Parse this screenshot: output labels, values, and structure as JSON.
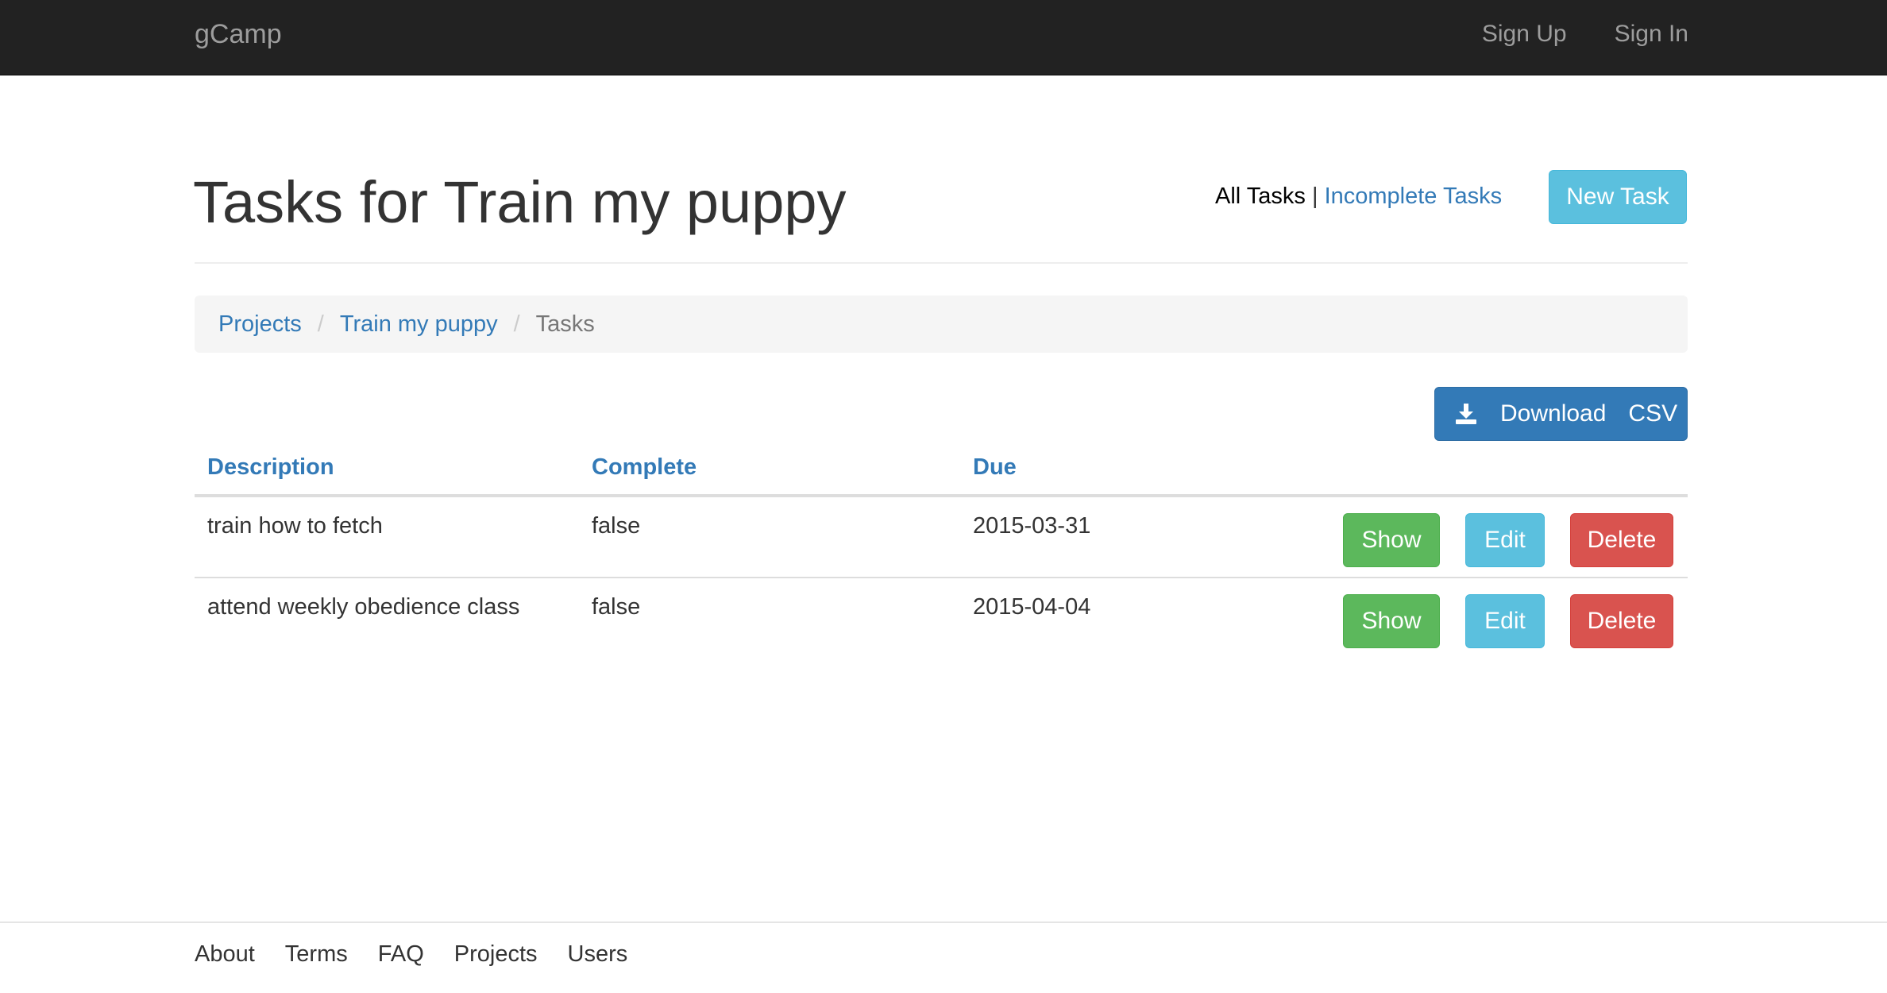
{
  "navbar": {
    "brand": "gCamp",
    "links": [
      "Sign Up",
      "Sign In"
    ]
  },
  "header": {
    "title": "Tasks for Train my puppy",
    "filter_all": "All Tasks",
    "filter_separator": "|",
    "filter_incomplete": "Incomplete Tasks",
    "new_task_label": "New Task"
  },
  "breadcrumb": {
    "items": [
      "Projects",
      "Train my puppy",
      "Tasks"
    ],
    "separator": "/"
  },
  "download": {
    "label_word1": "Download",
    "label_word2": "CSV",
    "icon": "download-icon"
  },
  "table": {
    "columns": [
      "Description",
      "Complete",
      "Due"
    ],
    "rows": [
      {
        "description": "train how to fetch",
        "complete": "false",
        "due": "2015-03-31"
      },
      {
        "description": "attend weekly obedience class",
        "complete": "false",
        "due": "2015-04-04"
      }
    ],
    "actions": {
      "show": "Show",
      "edit": "Edit",
      "delete": "Delete"
    }
  },
  "footer": {
    "links": [
      "About",
      "Terms",
      "FAQ",
      "Projects",
      "Users"
    ]
  },
  "colors": {
    "navbar_bg": "#222222",
    "link": "#337ab7",
    "info": "#5bc0de",
    "success": "#5cb85c",
    "danger": "#d9534f",
    "primary": "#337ab7"
  }
}
